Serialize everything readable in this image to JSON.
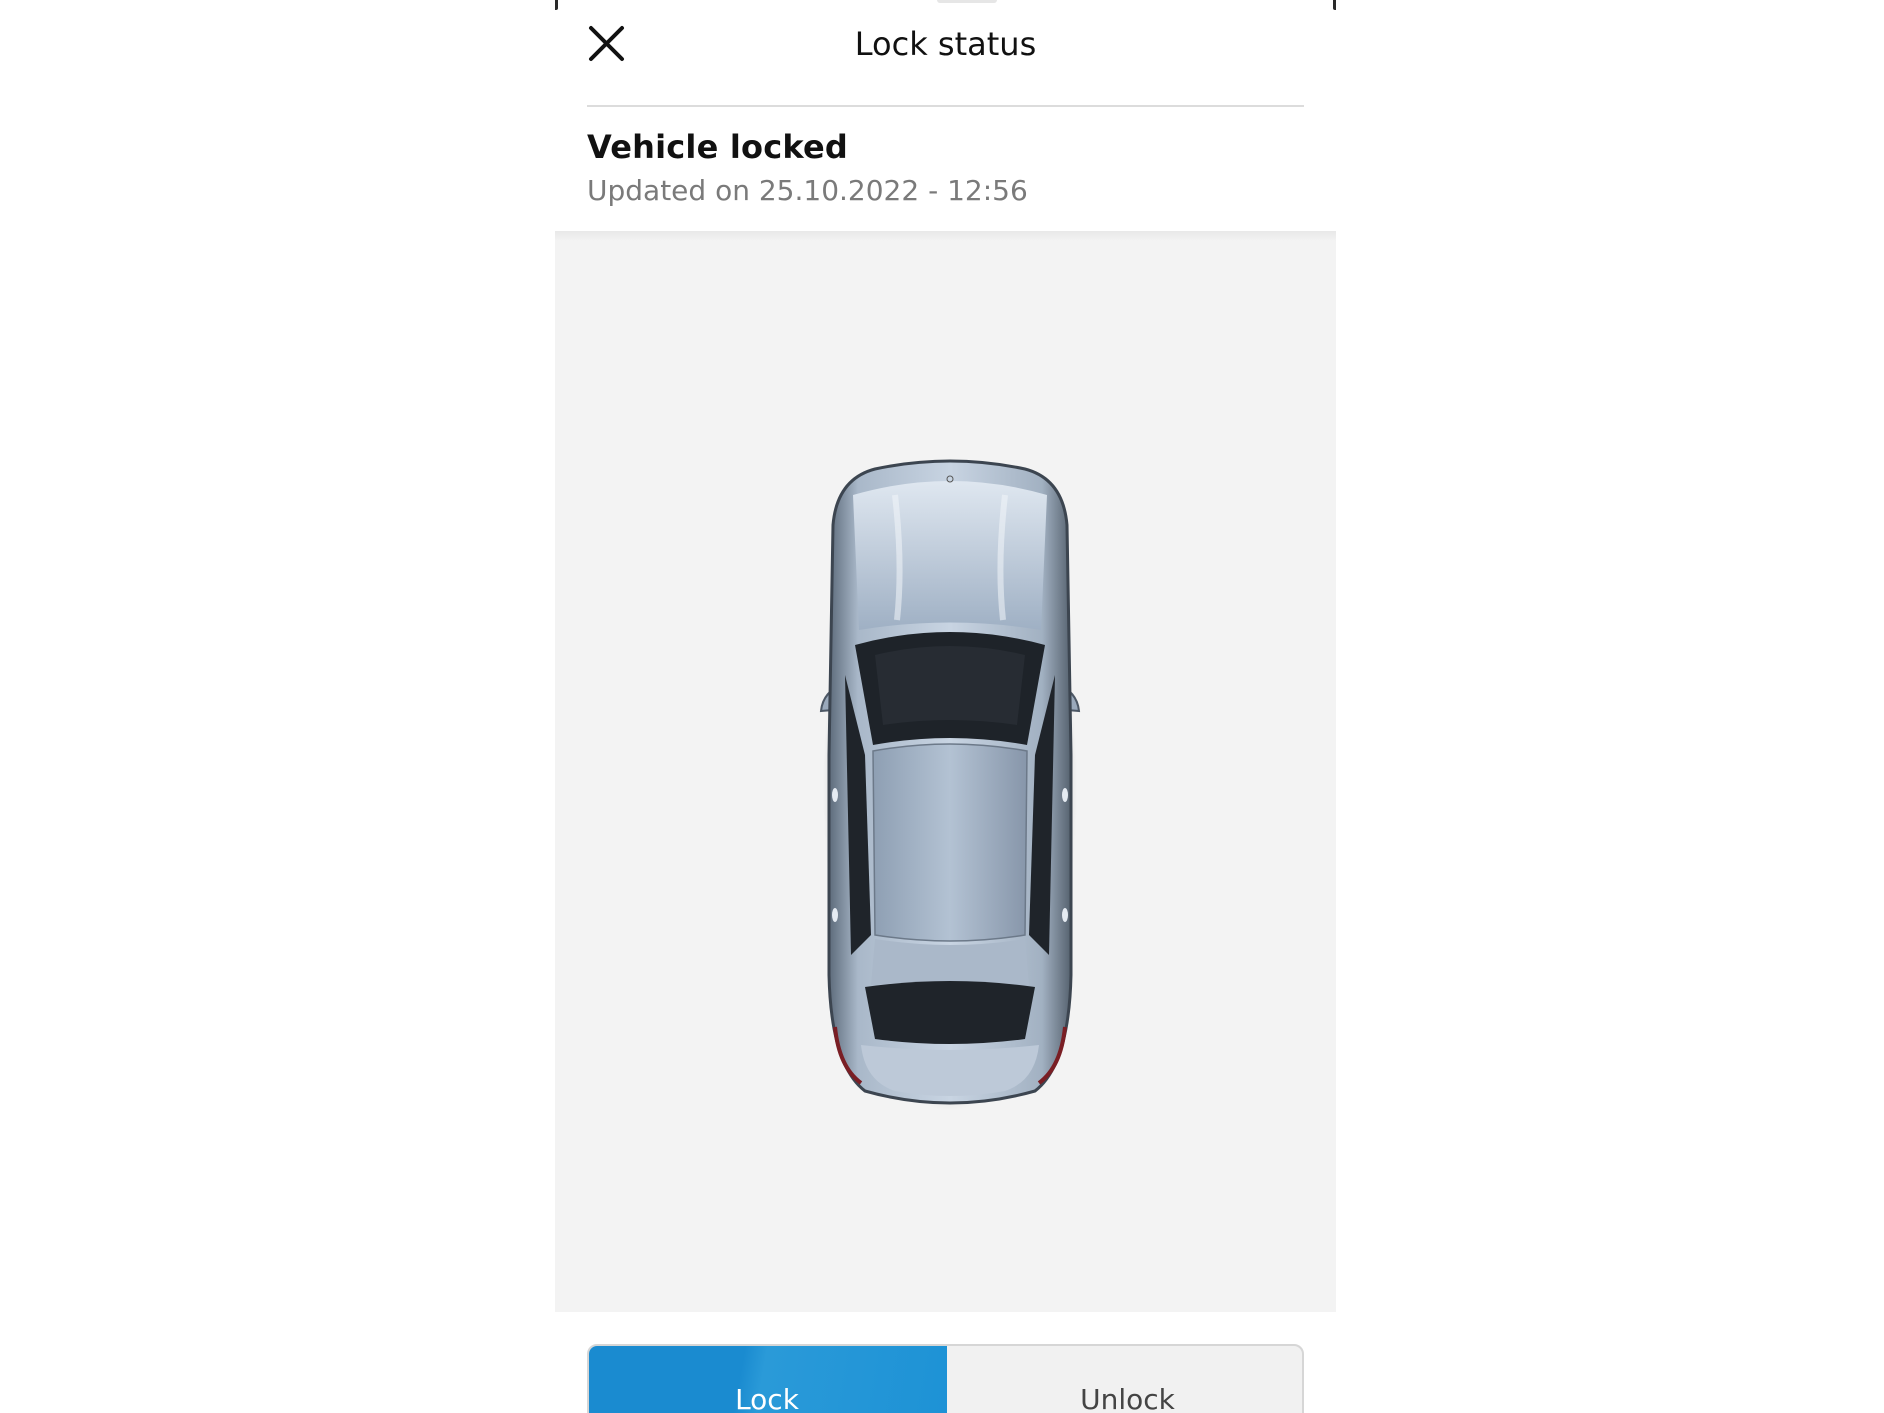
{
  "header": {
    "title": "Lock status",
    "close_icon": "close-icon"
  },
  "status": {
    "title": "Vehicle locked",
    "updated": "Updated on 25.10.2022 - 12:56"
  },
  "vehicle": {
    "image": "car-top-view",
    "color": "#9fb1c6"
  },
  "controls": {
    "lock_label": "Lock",
    "unlock_label": "Unlock",
    "selected": "Lock",
    "accent_color": "#1a8bd0"
  }
}
